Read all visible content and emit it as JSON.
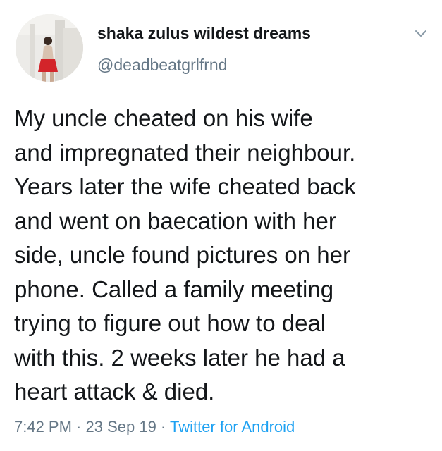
{
  "author": {
    "display_name": "shaka zulus wildest dreams",
    "handle": "@deadbeatgrlfrnd",
    "avatar_icon": "profile-photo"
  },
  "tweet": {
    "lines": [
      "My uncle cheated on his wife",
      "and impregnated their neighbour.",
      "Years later the wife cheated back",
      "and went on baecation with her",
      "side, uncle found pictures on her",
      "phone. Called a family meeting",
      "trying to figure out how to deal",
      "with this. 2 weeks later he had a",
      "heart attack & died."
    ]
  },
  "meta": {
    "time": "7:42 PM",
    "separator": " · ",
    "date": "23 Sep 19",
    "source": "Twitter for Android"
  },
  "menu": {
    "icon": "chevron-down-icon"
  },
  "colors": {
    "text": "#14171a",
    "secondary": "#657786",
    "link": "#1da1f2",
    "background": "#ffffff"
  }
}
